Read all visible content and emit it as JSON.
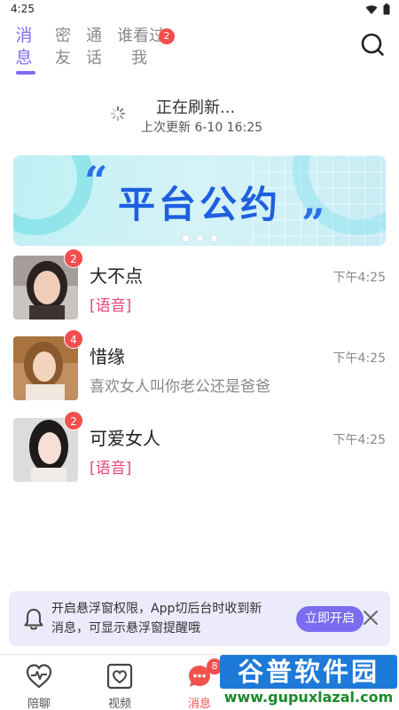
{
  "status_bar": {
    "time": "4:25",
    "wifi_icon": "wifi-icon",
    "battery_icon": "battery-icon"
  },
  "tabs": {
    "items": [
      {
        "label": "消息",
        "active": true
      },
      {
        "label": "密友",
        "active": false
      },
      {
        "label": "通话",
        "active": false
      },
      {
        "label": "谁看过我",
        "active": false
      }
    ],
    "who_viewed_badge": "2",
    "search_icon": "search-icon"
  },
  "refresh": {
    "title": "正在刷新...",
    "subtitle": "上次更新 6-10 16:25"
  },
  "banner": {
    "title": "平台公约",
    "quote_open": "“",
    "quote_close": "”",
    "dot_count": 3,
    "active_dot": 0
  },
  "messages": [
    {
      "name": "大不点",
      "text": "[语音]",
      "is_voice": true,
      "time": "下午4:25",
      "unread": "2"
    },
    {
      "name": "惜缘",
      "text": "喜欢女人叫你老公还是爸爸",
      "is_voice": false,
      "time": "下午4:25",
      "unread": "4"
    },
    {
      "name": "可爱女人",
      "text": "[语音]",
      "is_voice": true,
      "time": "下午4:25",
      "unread": "2"
    }
  ],
  "notice": {
    "line1": "开启悬浮窗权限，App切后台时收到新",
    "line2": "消息，可显示悬浮窗提醒哦",
    "button": "立即开启",
    "bell_icon": "bell-icon",
    "close_icon": "close-icon"
  },
  "bottom_nav": {
    "items": [
      {
        "label": "陪聊",
        "icon": "heartbeat-icon",
        "active": false
      },
      {
        "label": "视频",
        "icon": "video-heart-icon",
        "active": false
      },
      {
        "label": "消息",
        "icon": "message-icon",
        "active": true,
        "badge": "8"
      }
    ]
  },
  "watermark": {
    "title": "谷普软件园",
    "url": "www.gupuxlazal.com"
  },
  "colors": {
    "accent": "#7b6cf0",
    "badge": "#f24e4e",
    "voice": "#e8457a",
    "banner_title": "#1d5fe0"
  }
}
